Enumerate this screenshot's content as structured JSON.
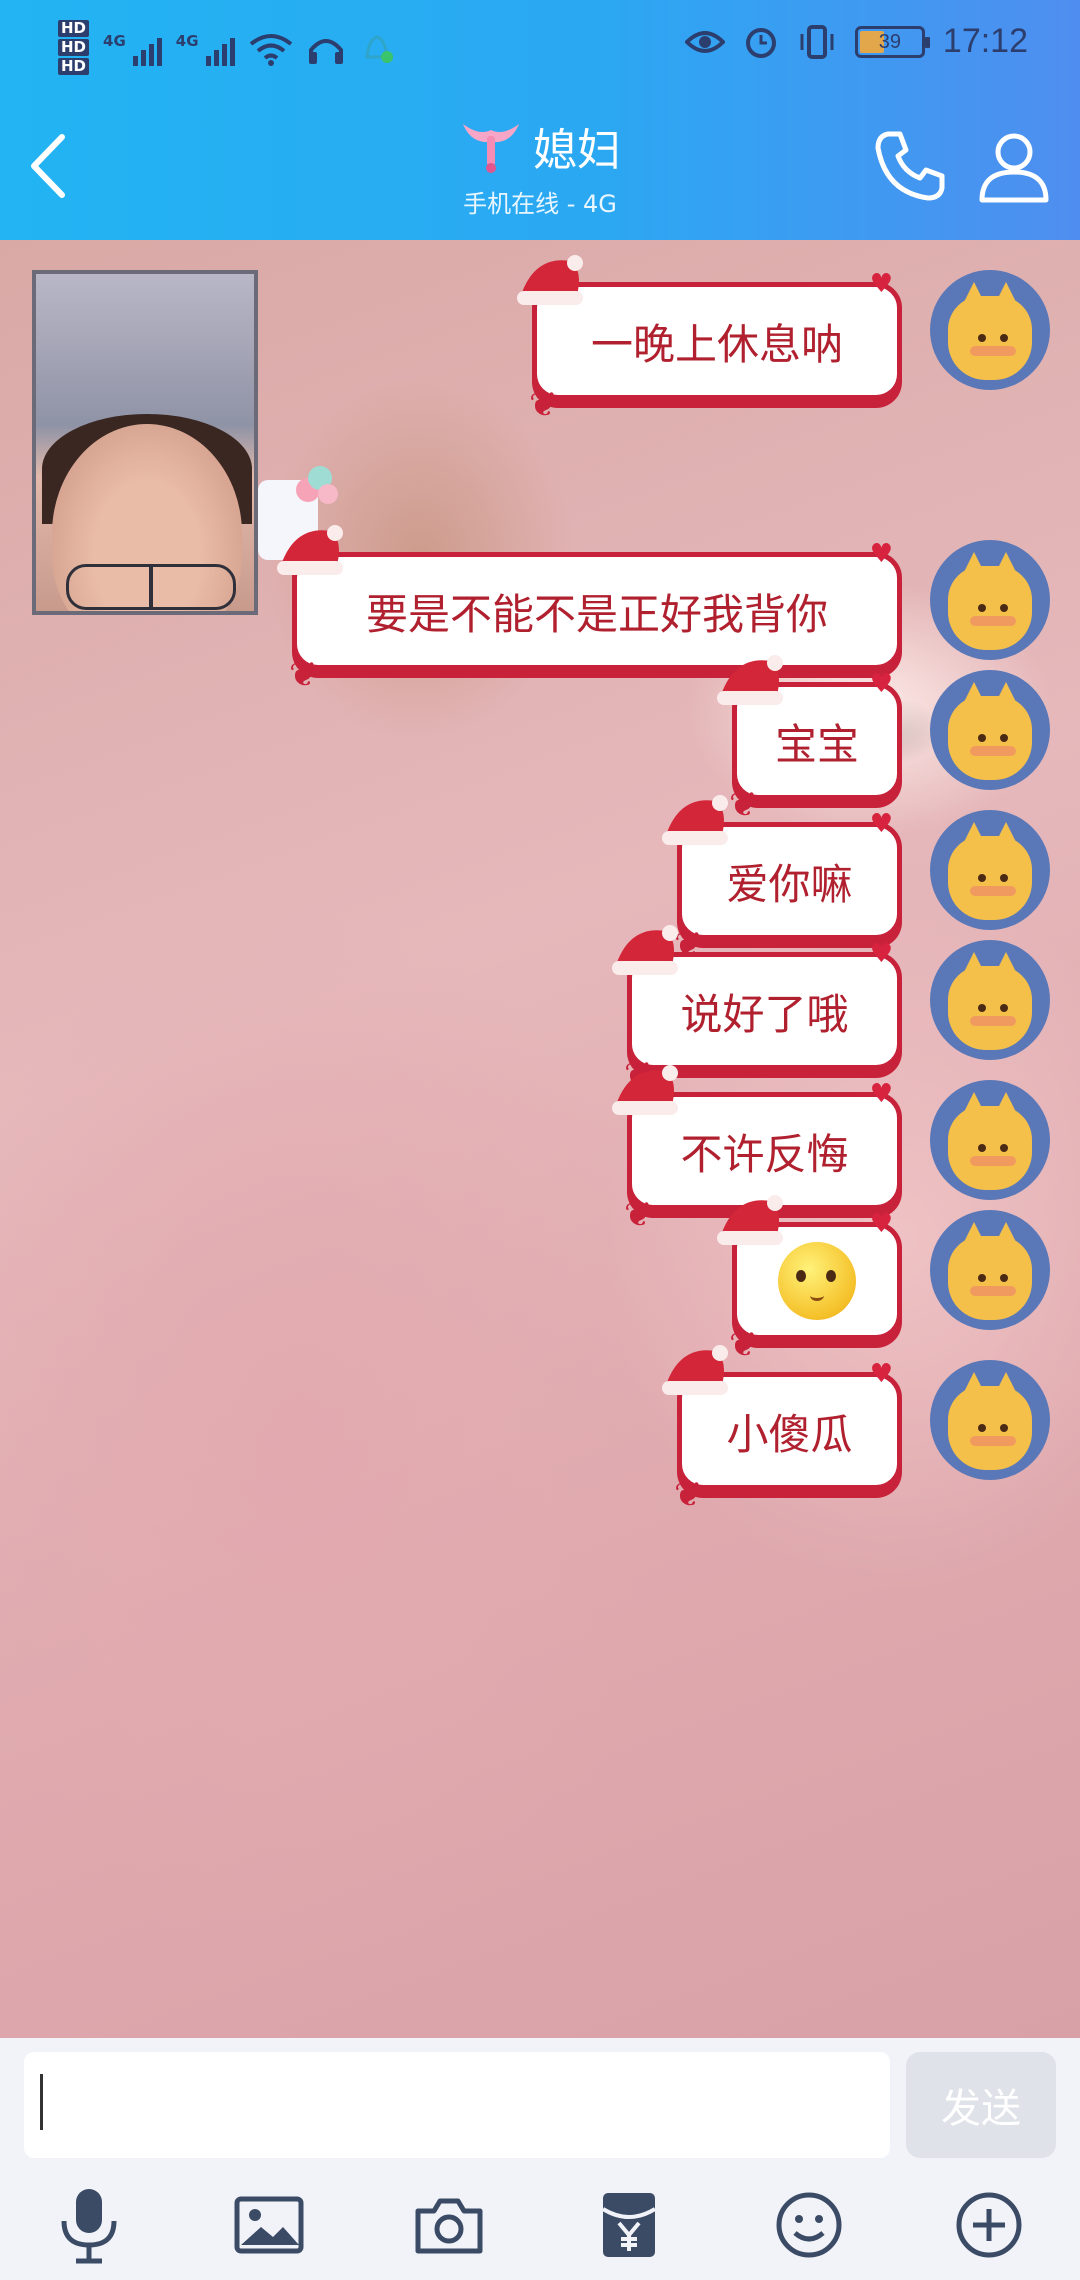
{
  "status_bar": {
    "net_label_1": "4G",
    "net_label_2": "4G",
    "battery": "39",
    "time": "17:12",
    "icons": [
      "hd-icon",
      "signal-icon",
      "wifi-icon",
      "headset-icon",
      "eye-icon",
      "alarm-icon",
      "vibrate-icon",
      "battery-icon"
    ]
  },
  "header": {
    "title": "媳妇",
    "subtitle": "手机在线 - 4G",
    "icons": [
      "back-icon",
      "pendant-icon",
      "phone-icon",
      "profile-icon"
    ]
  },
  "messages": [
    {
      "text": "一晚上休息呐",
      "emoji": false
    },
    {
      "text": "要是不能不是正好我背你",
      "emoji": false
    },
    {
      "text": "宝宝",
      "emoji": false
    },
    {
      "text": "爱你嘛",
      "emoji": false
    },
    {
      "text": "说好了哦",
      "emoji": false
    },
    {
      "text": "不许反悔",
      "emoji": false
    },
    {
      "text": "",
      "emoji": true,
      "emoji_name": "shy-face-emoji"
    },
    {
      "text": "小傻瓜",
      "emoji": false
    }
  ],
  "composer": {
    "input_value": "",
    "send_label": "发送",
    "toolbar_icons": [
      "microphone-icon",
      "image-icon",
      "camera-icon",
      "red-packet-icon",
      "emoji-icon",
      "plus-icon"
    ]
  },
  "colors": {
    "header_start": "#22b4f3",
    "header_end": "#4f8ef0",
    "bubble_border": "#c8213a",
    "bubble_text": "#b0202e",
    "toolbar_icon": "#3b4b66"
  }
}
